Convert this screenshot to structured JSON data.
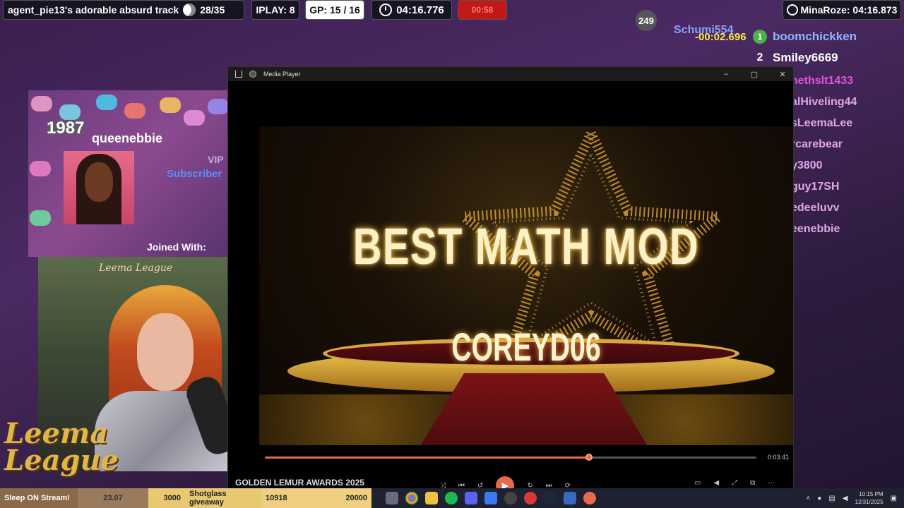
{
  "hud": {
    "track": "agent_pie13's adorable absurd track",
    "track_count": "28/35",
    "iplay": "IPLAY: 8",
    "gp": "GP: 15 / 16",
    "timer": "04:16.776",
    "red": "00:58",
    "record": "MinaRoze: 04:16.873"
  },
  "ghost": {
    "count": "249",
    "name": "Schumi554",
    "time": "-00:02.696"
  },
  "ranking": {
    "first": {
      "rank": "1",
      "name": "boomchickken"
    },
    "second": {
      "rank": "2",
      "name": "Smiley6669"
    },
    "rows": [
      "nethslt1433",
      "alHiveling44",
      "sLeemaLee",
      "rcarebear",
      "y3800",
      "guy17SH",
      "edeeluvv",
      "eenebbie"
    ]
  },
  "sub_card": {
    "months": "1987",
    "username": "queenebbie",
    "vip": "VIP",
    "subscriber": "Subscriber",
    "joined": "Joined With:"
  },
  "webcam": {
    "sign": "Leema League"
  },
  "logo": {
    "line1": "Leema",
    "line2": "League"
  },
  "player": {
    "title": "Media Player",
    "video_title": "BEST MATH MOD",
    "video_subtitle": "COREYD06",
    "progress": 0.66,
    "total_time": "0:03:41",
    "footer_title": "GOLDEN LEMUR AWARDS 2025"
  },
  "taskbar": {
    "ticker": [
      "Sleep ON Stream!",
      "23.07",
      "3000",
      "Shotglass giveaway",
      "10918",
      "20000"
    ],
    "time": "10:15 PM",
    "date": "12/31/2025"
  },
  "colors": {
    "accent": "#e86a4a",
    "leader": "#e0a6e6",
    "gold": "#e0b54a"
  }
}
